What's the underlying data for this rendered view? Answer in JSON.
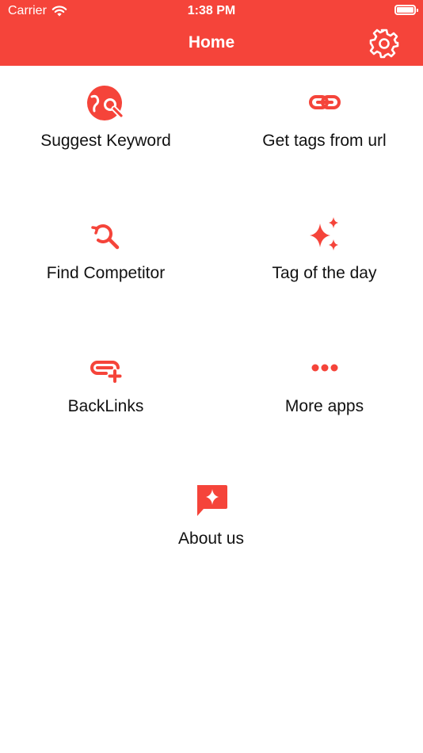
{
  "status_bar": {
    "carrier": "Carrier",
    "time": "1:38 PM"
  },
  "nav": {
    "title": "Home",
    "settings_icon": "gear-icon"
  },
  "accent_color": "#F5443A",
  "tiles": [
    {
      "label": "Suggest Keyword",
      "icon": "keyword-search-icon"
    },
    {
      "label": "Get tags from url",
      "icon": "link-icon"
    },
    {
      "label": "Find Competitor",
      "icon": "history-search-icon"
    },
    {
      "label": "Tag of the day",
      "icon": "sparkles-icon"
    },
    {
      "label": "BackLinks",
      "icon": "add-link-icon"
    },
    {
      "label": "More apps",
      "icon": "more-dots-icon"
    },
    {
      "label": "About us",
      "icon": "chat-sparkle-icon"
    }
  ]
}
